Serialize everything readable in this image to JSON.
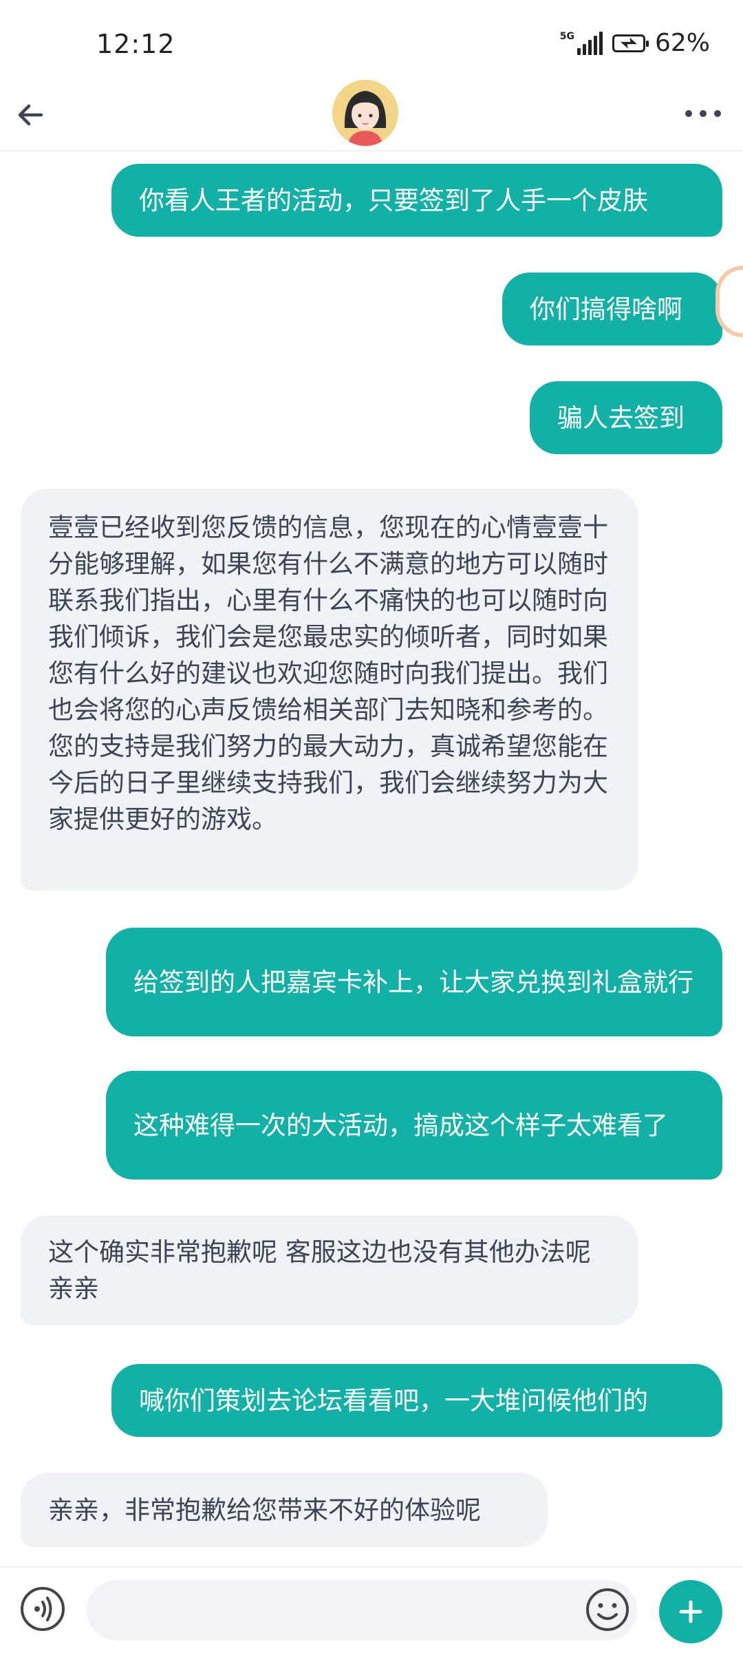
{
  "status": {
    "time": "12:12",
    "network": "5G",
    "battery": "62%"
  },
  "header": {
    "back_icon": "arrow-left-icon",
    "avatar": "customer-service-avatar",
    "more_icon": "more-dots-icon"
  },
  "messages": [
    {
      "side": "out",
      "text": "你看人王者的活动，只要签到了人手一个皮肤"
    },
    {
      "side": "out",
      "text": "你们搞得啥啊"
    },
    {
      "side": "out",
      "text": "骗人去签到"
    },
    {
      "side": "in",
      "text": "壹壹已经收到您反馈的信息，您现在的心情壹壹十分能够理解，如果您有什么不满意的地方可以随时联系我们指出，心里有什么不痛快的也可以随时向我们倾诉，我们会是您最忠实的倾听者，同时如果您有什么好的建议也欢迎您随时向我们提出。我们也会将您的心声反馈给相关部门去知晓和参考的。您的支持是我们努力的最大动力，真诚希望您能在今后的日子里继续支持我们，我们会继续努力为大家提供更好的游戏。"
    },
    {
      "side": "out",
      "text": "给签到的人把嘉宾卡补上，让大家兑换到礼盒就行"
    },
    {
      "side": "out",
      "text": "这种难得一次的大活动，搞成这个样子太难看了"
    },
    {
      "side": "in",
      "text": "这个确实非常抱歉呢 客服这边也没有其他办法呢 亲亲"
    },
    {
      "side": "out",
      "text": "喊你们策划去论坛看看吧，一大堆问候他们的"
    },
    {
      "side": "in",
      "text": "亲亲，非常抱歉给您带来不好的体验呢"
    }
  ],
  "composer": {
    "voice_icon": "voice-icon",
    "input_value": "",
    "emoji_icon": "emoji-icon",
    "plus_icon": "plus-icon"
  },
  "colors": {
    "accent": "#12b0a6",
    "incoming_bubble": "#eff2f6",
    "incoming_text": "#3d4457"
  }
}
